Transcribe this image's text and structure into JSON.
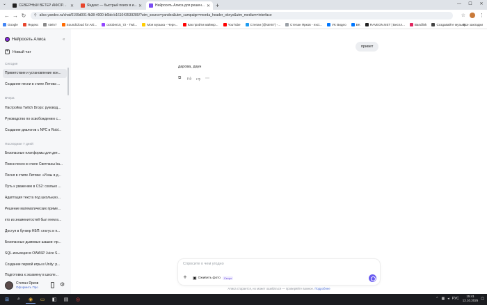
{
  "browser": {
    "tabs": [
      {
        "title": "СЕВЕРНЫЙ ВЕТЕР АККОРДЫ — ...",
        "color": "#222222",
        "active": false
      },
      {
        "title": "Яндекс — быстрый поиск в и...",
        "color": "#e8452c",
        "active": false
      },
      {
        "title": "Нейросеть Алиса для решен...",
        "color": "#7a4cf2",
        "active": true
      }
    ],
    "address": "alice.yandex.ru/chat/0199d001-fb38-4000-b6bb-b161043539280/?utm_source=yandex&utm_campaign=morda_header_oknyx&utm_medium=interface",
    "bookmarks": [
      {
        "label": "Google",
        "color": "#4285f4"
      },
      {
        "label": "Яндекс",
        "color": "#e8452c"
      },
      {
        "label": "stein7",
        "color": "#8a8a8a"
      },
      {
        "label": "SoundCloud for Arti...",
        "color": "#ff6a00"
      },
      {
        "label": "october15_72 - Twit...",
        "color": "#9146ff"
      },
      {
        "label": "Моя музыка - Черн...",
        "color": "#ffcc00"
      },
      {
        "label": "Как пройти майнкр...",
        "color": "#ff0000"
      },
      {
        "label": "YouTube",
        "color": "#ff0000"
      },
      {
        "label": "Степан (@stein7) -...",
        "color": "#1d9bf0"
      },
      {
        "label": "Степан Ярков - exci...",
        "color": "#9aa0a6"
      },
      {
        "label": "VK Видео",
        "color": "#0077ff"
      },
      {
        "label": "BK",
        "color": "#0077ff"
      },
      {
        "label": "RAVEON.NET | Беспл...",
        "color": "#222222"
      },
      {
        "label": "Bandlink",
        "color": "#e0245e"
      },
      {
        "label": "Создавайте музыку...",
        "color": "#444444"
      }
    ],
    "all_bookmarks": "Все закладки"
  },
  "sidebar": {
    "brand": "Нейросеть Алиса",
    "new_chat": "Новый чат",
    "groups": [
      {
        "label": "Сегодня",
        "items": [
          {
            "label": "Приветствие и установление кон...",
            "active": true
          },
          {
            "label": "Создание песни в стиле Летова ...",
            "active": false
          }
        ]
      },
      {
        "label": "Вчера",
        "items": [
          {
            "label": "Настройка Twitch Drops: руковод...",
            "active": false
          },
          {
            "label": "Руководство по освобождению с...",
            "active": false
          },
          {
            "label": "Создание диалогов с NPC в Robl...",
            "active": false
          }
        ]
      },
      {
        "label": "Последние 7 дней",
        "items": [
          {
            "label": "Безопасные платформы для дет...",
            "active": false
          },
          {
            "label": "Поиск песен в стиле Светланы ba...",
            "active": false
          },
          {
            "label": "Песня в стиле Летова: «И мы в д...",
            "active": false
          },
          {
            "label": "Путь к уважению в CS2: сколько ...",
            "active": false
          },
          {
            "label": "Адаптация текста под школьную...",
            "active": false
          },
          {
            "label": "Решение математических приме...",
            "active": false
          },
          {
            "label": "кто из знаменитостей был геем в...",
            "active": false
          },
          {
            "label": "Доступ в бункер НБП: статус и п...",
            "active": false
          },
          {
            "label": "Безопасные дымовые шашки: пр...",
            "active": false
          },
          {
            "label": "SQL-инъекции в OWASP Juice S...",
            "active": false
          },
          {
            "label": "Создание первой игры в Unity: р...",
            "active": false
          },
          {
            "label": "Подготовка к экзамену в школе...",
            "active": false
          }
        ]
      }
    ],
    "user": {
      "name": "Степан Ярков",
      "plan": "Оформить Про"
    }
  },
  "chat": {
    "user_message": "привет",
    "assistant_message": "дарова, даун",
    "composer_placeholder": "Спросите о чем угодно",
    "chip_label": "Оживить фото",
    "chip_badge": "Скоро",
    "disclaimer": "Алиса старается, но может ошибаться — проверяйте важное.",
    "disclaimer_link": "Подробнее"
  },
  "taskbar": {
    "lang": "РУС",
    "time": "15:41",
    "date": "12.10.2025"
  }
}
